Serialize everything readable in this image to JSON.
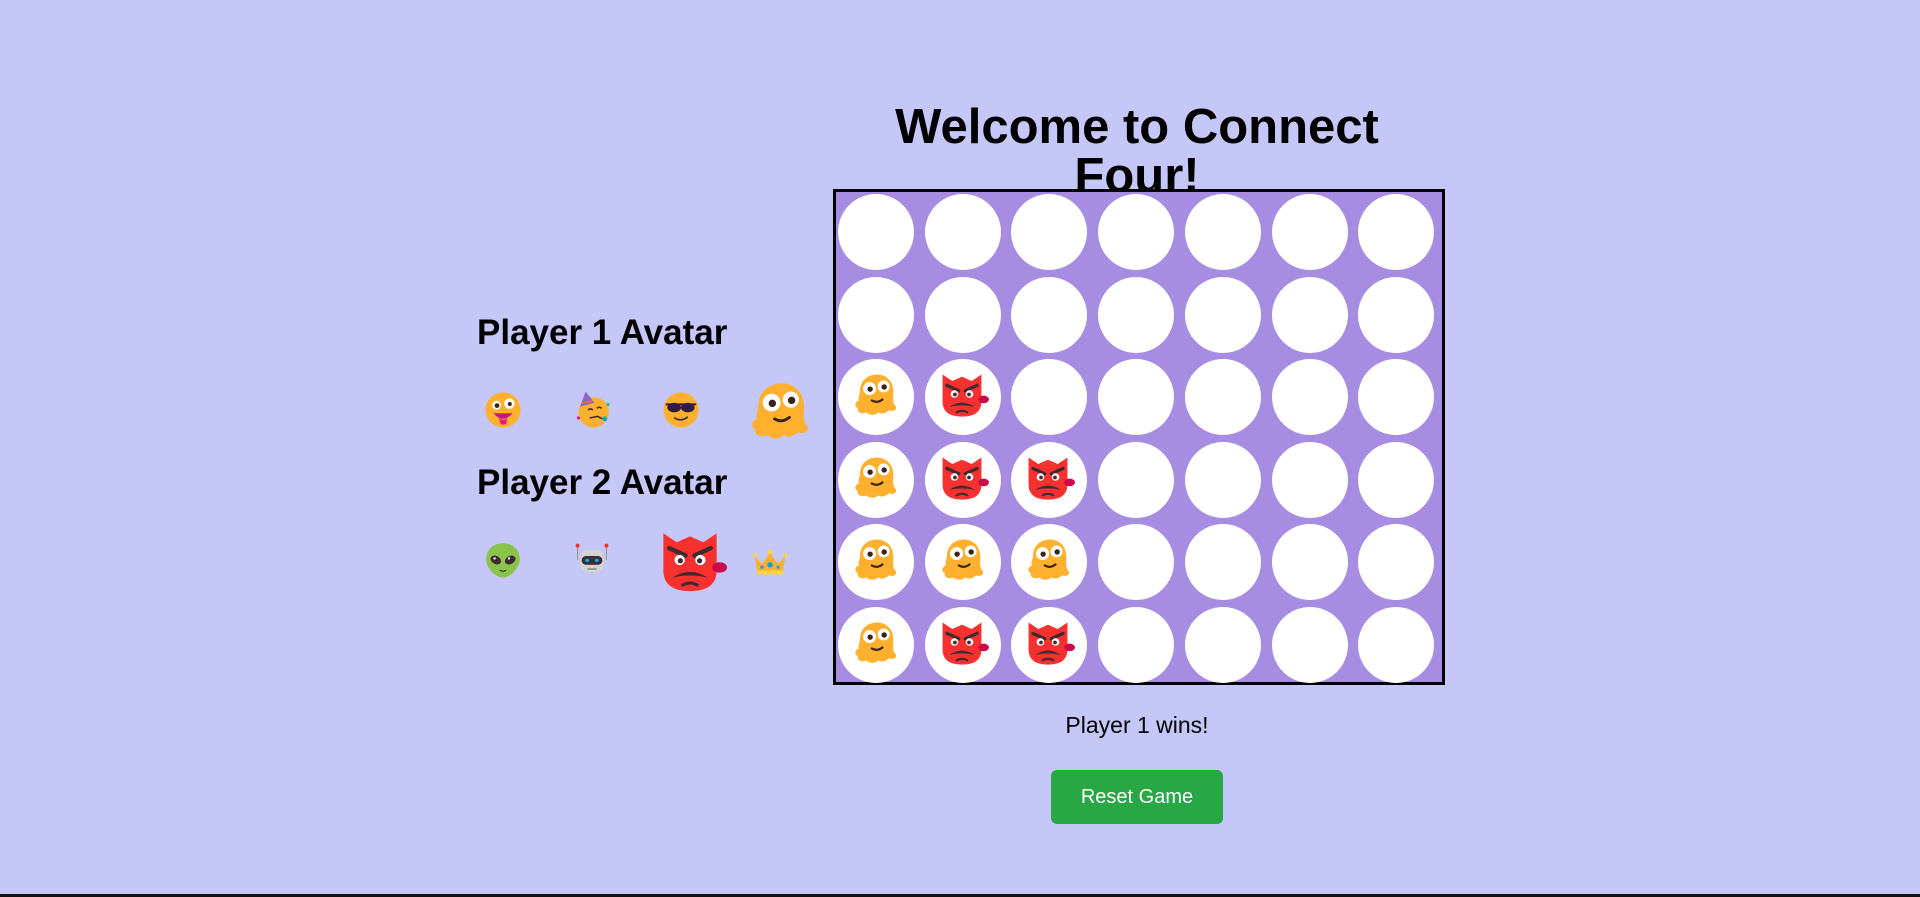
{
  "game": {
    "title": "Welcome to Connect Four!",
    "status": "Player 1 wins!",
    "reset_label": "Reset Game",
    "rows": 6,
    "columns": 7,
    "player1_piece": "melting-face-icon",
    "player2_piece": "goblin-face-icon",
    "board": [
      [
        0,
        0,
        0,
        0,
        0,
        0,
        0
      ],
      [
        0,
        0,
        0,
        0,
        0,
        0,
        0
      ],
      [
        1,
        2,
        0,
        0,
        0,
        0,
        0
      ],
      [
        1,
        2,
        2,
        0,
        0,
        0,
        0
      ],
      [
        1,
        1,
        1,
        0,
        0,
        0,
        0
      ],
      [
        1,
        2,
        2,
        0,
        0,
        0,
        0
      ]
    ]
  },
  "avatars": {
    "player1_heading": "Player 1 Avatar",
    "player2_heading": "Player 2 Avatar",
    "player1_options": [
      "zany-face-icon",
      "partying-face-icon",
      "sunglasses-face-icon",
      "melting-face-icon"
    ],
    "player2_options": [
      "alien-icon",
      "robot-icon",
      "goblin-face-icon",
      "crown-icon"
    ],
    "player1_selected": "melting-face-icon",
    "player2_selected": "goblin-face-icon"
  },
  "colors": {
    "background": "#c5c7f8",
    "board": "#a78de2",
    "slot": "#ffffff",
    "reset_button": "#28a745"
  }
}
